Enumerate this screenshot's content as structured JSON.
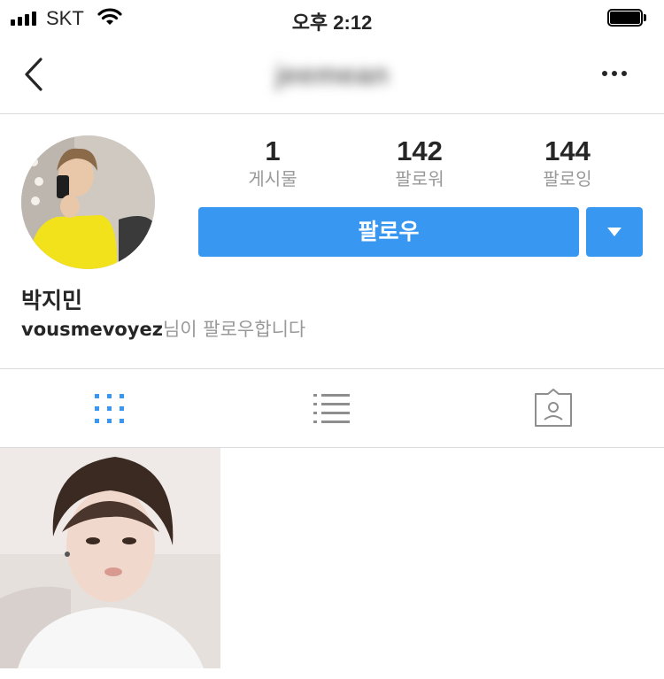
{
  "status_bar": {
    "carrier": "SKT",
    "time": "오후 2:12"
  },
  "nav": {
    "username": "jeemean"
  },
  "profile": {
    "stats": [
      {
        "value": "1",
        "label": "게시물"
      },
      {
        "value": "142",
        "label": "팔로워"
      },
      {
        "value": "144",
        "label": "팔로잉"
      }
    ],
    "follow_label": "팔로우",
    "full_name": "박지민",
    "followed_by_user": "vousmevoyez",
    "followed_by_suffix": "님이 팔로우합니다"
  },
  "tabs": [
    {
      "icon": "grid-icon",
      "active": true
    },
    {
      "icon": "list-icon",
      "active": false
    },
    {
      "icon": "tagged-icon",
      "active": false
    }
  ],
  "colors": {
    "accent": "#3897f0",
    "text": "#262626",
    "muted": "#999999",
    "divider": "#dbdbdb"
  }
}
